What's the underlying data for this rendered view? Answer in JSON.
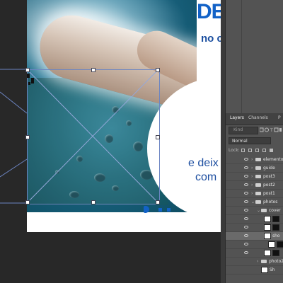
{
  "artwork": {
    "headline": "DE",
    "subheadline": "no c",
    "body_line1": "e deix",
    "body_line2": "com"
  },
  "panel": {
    "tabs": [
      {
        "label": "Layers",
        "active": true
      },
      {
        "label": "Channels",
        "active": false
      },
      {
        "label": "P",
        "active": false
      }
    ],
    "search_placeholder": "Kind",
    "blend_mode": "Normal",
    "lock_label": "Lock:",
    "layers": [
      {
        "name": "elementos",
        "type": "folder",
        "indent": 0,
        "visible": true,
        "selected": false
      },
      {
        "name": "guide",
        "type": "folder",
        "indent": 0,
        "visible": true,
        "selected": false
      },
      {
        "name": "post3",
        "type": "folder",
        "indent": 0,
        "visible": true,
        "selected": false
      },
      {
        "name": "post2",
        "type": "folder",
        "indent": 0,
        "visible": true,
        "selected": false
      },
      {
        "name": "post1",
        "type": "folder",
        "indent": 0,
        "visible": true,
        "selected": false
      },
      {
        "name": "photos",
        "type": "folder",
        "indent": 0,
        "visible": true,
        "selected": false
      },
      {
        "name": "cover",
        "type": "folder",
        "indent": 1,
        "visible": true,
        "selected": false
      },
      {
        "name": "",
        "type": "layer",
        "indent": 2,
        "visible": true,
        "selected": false
      },
      {
        "name": "",
        "type": "layer",
        "indent": 2,
        "visible": true,
        "selected": false
      },
      {
        "name": "sho",
        "type": "layer",
        "indent": 2,
        "visible": true,
        "selected": true
      },
      {
        "name": "",
        "type": "layer",
        "indent": 2,
        "visible": true,
        "selected": false
      },
      {
        "name": "",
        "type": "layer",
        "indent": 2,
        "visible": true,
        "selected": false
      },
      {
        "name": "photo2",
        "type": "folder",
        "indent": 1,
        "visible": false,
        "selected": false
      },
      {
        "name": "Sh",
        "type": "layer",
        "indent": 1,
        "visible": false,
        "selected": false
      }
    ]
  },
  "colors": {
    "accent_blue": "#1262c7",
    "panel_bg": "#535353",
    "canvas_bg": "#282828"
  }
}
